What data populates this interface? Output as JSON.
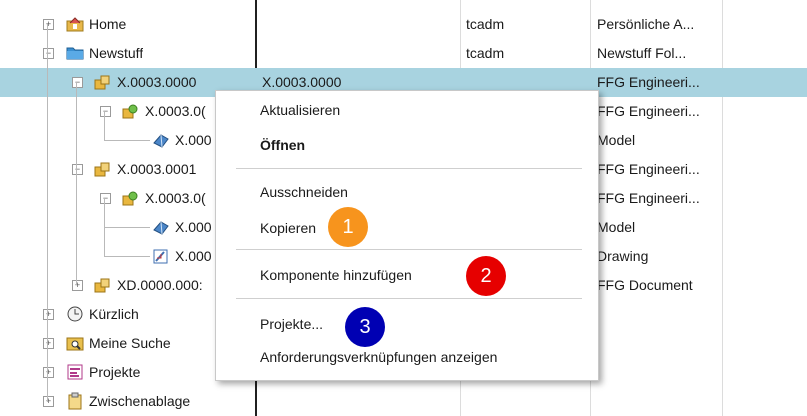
{
  "tree": {
    "rows": [
      {
        "name": "Home",
        "owner": "tcadm",
        "type": "Persönliche A..."
      },
      {
        "name": "Newstuff",
        "owner": "tcadm",
        "type": "Newstuff Fol..."
      },
      {
        "name": "X.0003.0000",
        "col2": "X.0003.0000",
        "type": "FFG Engineeri..."
      },
      {
        "name": "X.0003.0(",
        "type": "FFG Engineeri..."
      },
      {
        "name": "X.000",
        "type": "Model"
      },
      {
        "name": "X.0003.0001",
        "type": "FFG Engineeri..."
      },
      {
        "name": "X.0003.0(",
        "type": "FFG Engineeri..."
      },
      {
        "name": "X.000",
        "type": "Model"
      },
      {
        "name": "X.000",
        "type": "Drawing"
      },
      {
        "name": "XD.0000.000:",
        "type": "FFG Document"
      },
      {
        "name": "Kürzlich"
      },
      {
        "name": "Meine Suche"
      },
      {
        "name": "Projekte"
      },
      {
        "name": "Zwischenablage"
      }
    ]
  },
  "context_menu": {
    "items": [
      {
        "label": "Aktualisieren"
      },
      {
        "label": "Öffnen"
      },
      {
        "label": "Ausschneiden"
      },
      {
        "label": "Kopieren"
      },
      {
        "label": "Komponente hinzufügen"
      },
      {
        "label": "Projekte..."
      },
      {
        "label": "Anforderungsverknüpfungen anzeigen"
      }
    ]
  },
  "badges": [
    {
      "label": "1",
      "color": "#f7941d"
    },
    {
      "label": "2",
      "color": "#e60000"
    },
    {
      "label": "3",
      "color": "#0000b3"
    }
  ],
  "colors": {
    "selection": "#a8d3e0"
  },
  "icons": [
    "home-folder-icon",
    "folder-icon",
    "assembly-icon",
    "part-icon",
    "model-icon",
    "drawing-icon",
    "document-icon",
    "clock-icon",
    "search-folder-icon",
    "project-icon",
    "clipboard-icon"
  ]
}
